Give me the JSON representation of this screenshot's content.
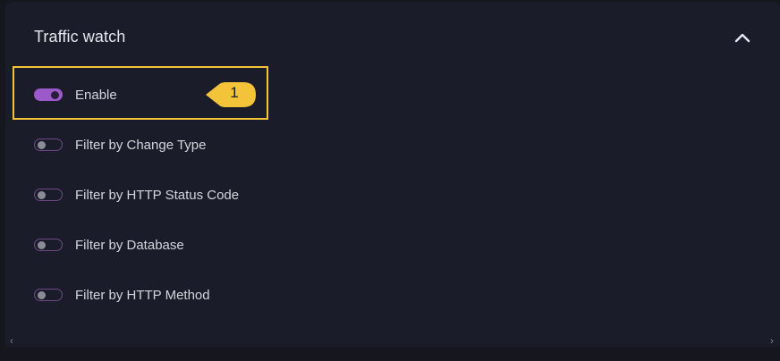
{
  "panel": {
    "title": "Traffic watch"
  },
  "toggles": [
    {
      "label": "Enable",
      "on": true
    },
    {
      "label": "Filter by Change Type",
      "on": false
    },
    {
      "label": "Filter by HTTP Status Code",
      "on": false
    },
    {
      "label": "Filter by Database",
      "on": false
    },
    {
      "label": "Filter by HTTP Method",
      "on": false
    }
  ],
  "annotation": {
    "number": "1"
  },
  "colors": {
    "background": "#16161f",
    "panel": "#1b1c29",
    "accent": "#9b59c9",
    "highlight": "#f3c43a"
  },
  "icons": {
    "collapse": "chevron-up-icon",
    "scroll_left": "chevron-left-icon",
    "scroll_right": "chevron-right-icon"
  }
}
